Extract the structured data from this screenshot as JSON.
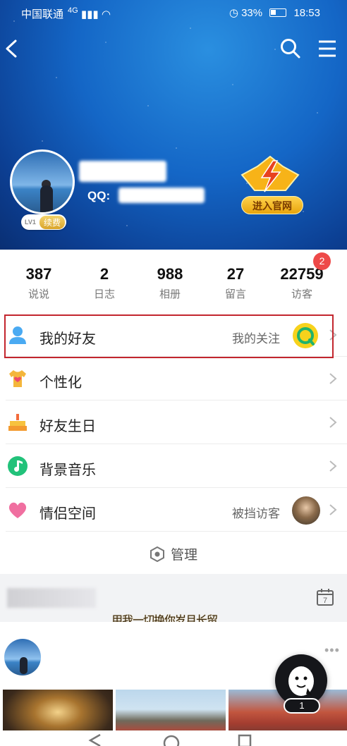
{
  "status_bar": {
    "carrier": "中国联通",
    "network": "4G",
    "battery_percent": "33%",
    "time": "18:53"
  },
  "header": {
    "qq_label": "QQ:",
    "level_text": "LV1",
    "renew_label": "续费",
    "vip_button_label": "进入官网"
  },
  "stats": [
    {
      "num": "387",
      "label": "说说"
    },
    {
      "num": "2",
      "label": "日志"
    },
    {
      "num": "988",
      "label": "相册"
    },
    {
      "num": "27",
      "label": "留言"
    },
    {
      "num": "22759",
      "label": "访客"
    }
  ],
  "visitor_badge": "2",
  "menu": {
    "friends": {
      "label": "我的好友",
      "sub": "我的关注"
    },
    "personalize": {
      "label": "个性化"
    },
    "birthday": {
      "label": "好友生日"
    },
    "music": {
      "label": "背景音乐"
    },
    "couple": {
      "label": "情侣空间",
      "sub": "被挡访客"
    },
    "manage": {
      "label": "管理"
    }
  },
  "feed": {
    "calendar_day": "7",
    "slogan": "用我一切换你岁月长留",
    "fab_count": "1"
  },
  "colors": {
    "accent_red": "#ee4a49",
    "highlight_border": "#c3262e",
    "vip_gold": "#ffd34d"
  }
}
